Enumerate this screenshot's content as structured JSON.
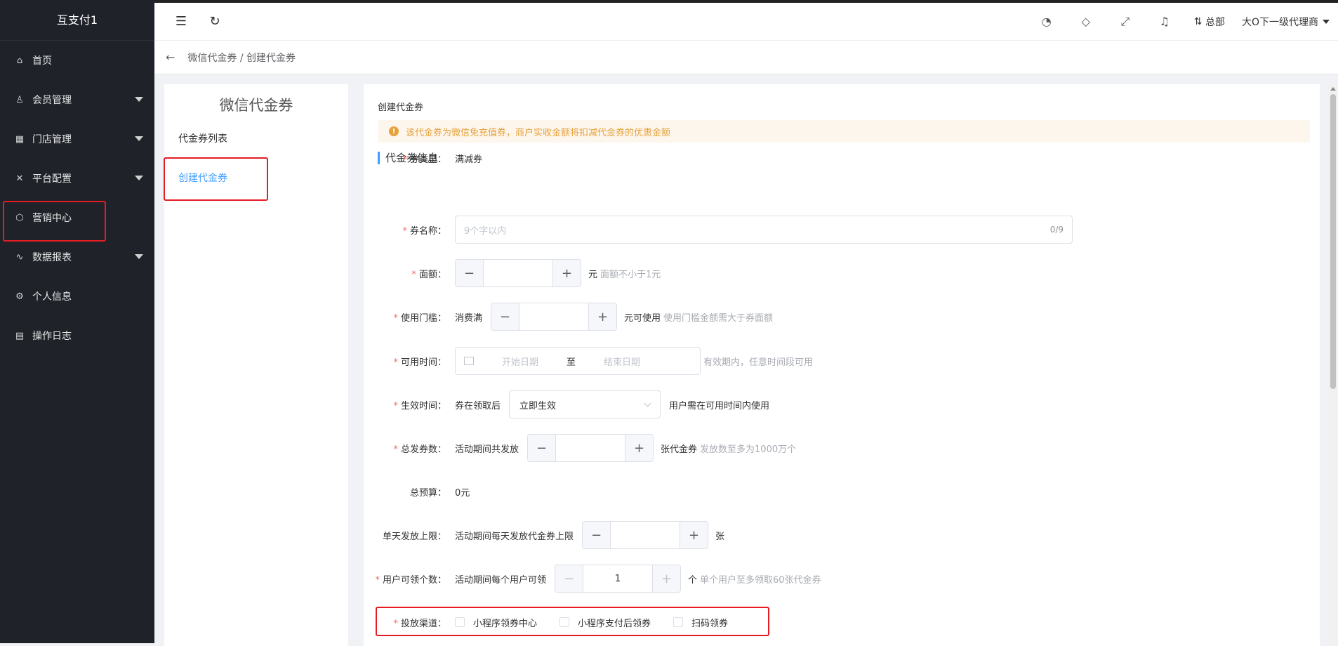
{
  "sidebar": {
    "title": "互支付1",
    "items": [
      {
        "label": "首页",
        "icon": "home-icon",
        "glyph": "⌂",
        "expandable": false
      },
      {
        "label": "会员管理",
        "icon": "user-icon",
        "glyph": "♙",
        "expandable": true
      },
      {
        "label": "门店管理",
        "icon": "store-icon",
        "glyph": "▦",
        "expandable": true
      },
      {
        "label": "平台配置",
        "icon": "tools-icon",
        "glyph": "✕",
        "expandable": true
      },
      {
        "label": "营销中心",
        "icon": "cube-icon",
        "glyph": "⬡",
        "expandable": false
      },
      {
        "label": "数据报表",
        "icon": "pulse-icon",
        "glyph": "∿",
        "expandable": true
      },
      {
        "label": "个人信息",
        "icon": "gear-icon",
        "glyph": "⚙",
        "expandable": false
      },
      {
        "label": "操作日志",
        "icon": "clipboard-icon",
        "glyph": "▤",
        "expandable": false
      }
    ]
  },
  "header": {
    "org_label": "总部",
    "user_label": "大O下一级代理商",
    "icons": [
      "palette-icon",
      "tag-icon",
      "fullscreen-icon",
      "bell-icon"
    ]
  },
  "breadcrumb": {
    "text": "微信代金券 / 创建代金券"
  },
  "left_panel": {
    "title": "微信代金券",
    "items": [
      {
        "label": "代金券列表",
        "active": false
      },
      {
        "label": "创建代金券",
        "active": true
      }
    ]
  },
  "main": {
    "title": "创建代金券",
    "alert": "该代金券为微信免充值券，商户实收金额将扣减代金券的优惠金额",
    "section_title": "代金券信息",
    "fields": {
      "type": {
        "label": "券类型：",
        "value": "满减券"
      },
      "name": {
        "label": "券名称：",
        "placeholder": "9个字以内",
        "count": "0/9"
      },
      "amount": {
        "label": "面额：",
        "value": "",
        "unit": "元",
        "hint": "面额不小于1元"
      },
      "threshold": {
        "label": "使用门槛：",
        "prefix": "消费满",
        "value": "",
        "unit": "元可使用",
        "hint": "使用门槛金额需大于券面额"
      },
      "time": {
        "label": "可用时间：",
        "start_placeholder": "开始日期",
        "separator": "至",
        "end_placeholder": "结束日期",
        "hint": "有效期内，任意时间段可用"
      },
      "effective": {
        "label": "生效时间：",
        "prefix": "券在领取后",
        "selected": "立即生效",
        "suffix": "用户需在可用时间内使用"
      },
      "total": {
        "label": "总发券数：",
        "prefix": "活动期间共发放",
        "value": "",
        "unit": "张代金券",
        "hint": "发放数至多为1000万个"
      },
      "budget": {
        "label": "总预算：",
        "value": "0元"
      },
      "daily": {
        "label": "单天发放上限：",
        "prefix": "活动期间每天发放代金券上限",
        "value": "",
        "unit": "张"
      },
      "per_user": {
        "label": "用户可领个数：",
        "prefix": "活动期间每个用户可领",
        "value": "1",
        "unit": "个",
        "hint": "单个用户至多领取60张代金券"
      },
      "channel": {
        "label": "投放渠道：",
        "options": [
          "小程序领券中心",
          "小程序支付后领券",
          "扫码领券"
        ]
      }
    }
  },
  "icons_glyphs": {
    "menu_fold": "☰",
    "refresh": "↻",
    "back": "←",
    "minus": "−",
    "plus": "+",
    "alert": "!"
  }
}
